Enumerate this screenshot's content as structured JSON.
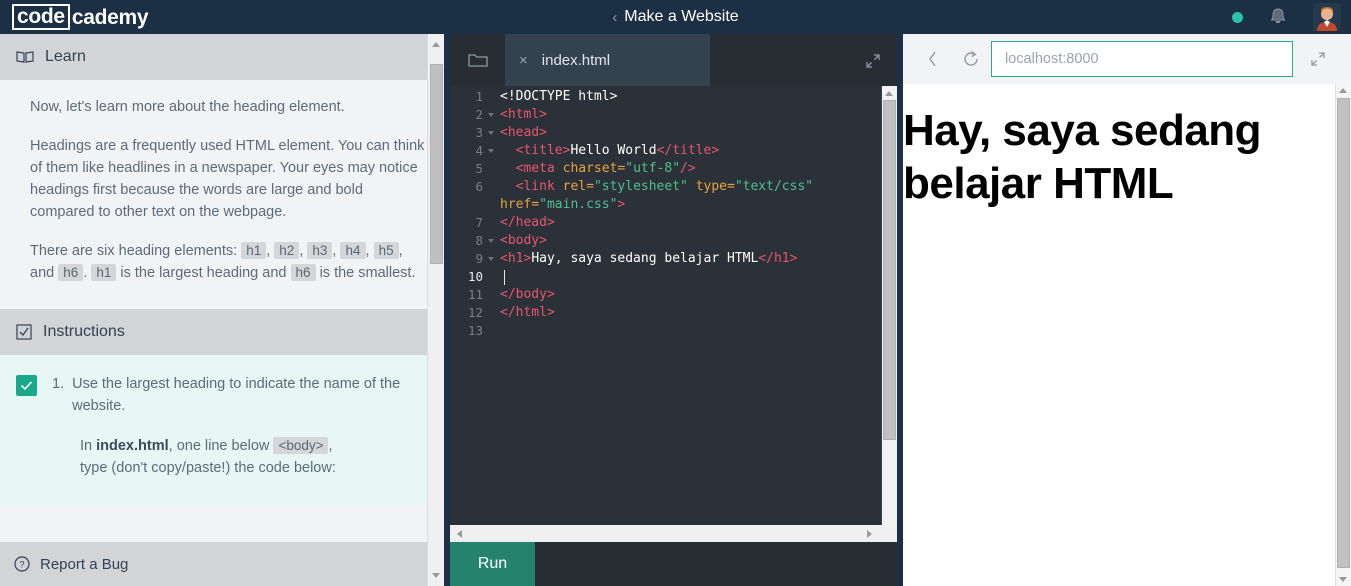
{
  "topbar": {
    "logo_boxed": "code",
    "logo_plain": "cademy",
    "back_chevron": "‹",
    "course_title": "Make a Website",
    "status_dot_color": "#29c3a8",
    "bell_icon": "bell-icon",
    "avatar_icon": "user-avatar"
  },
  "learn": {
    "header_label": "Learn",
    "header_icon": "book-icon",
    "paragraphs": [
      "Now, let's learn more about the heading element.",
      "Headings are a frequently used HTML element. You can think of them like headlines in a newspaper. Your eyes may notice headings first because the words are large and bold compared to other text on the webpage."
    ],
    "heading_sentence": {
      "pre": "There are six heading elements:",
      "codes": [
        "h1",
        "h2",
        "h3",
        "h4",
        "h5",
        "h6"
      ],
      "mid_and": "and",
      "tail_1": "h1",
      "tail_2": "is the largest heading and",
      "tail_3": "h6",
      "tail_4": "is the smallest."
    }
  },
  "instructions": {
    "header_label": "Instructions",
    "header_icon": "checkbox-checked-icon",
    "step_number": "1.",
    "step_checked": true,
    "step_text": "Use the largest heading to indicate the name of the website.",
    "sub_pre": "In",
    "sub_file": "index.html",
    "sub_mid": ", one line below",
    "sub_code": "<body>",
    "sub_post": ",",
    "sub_line2": "type (don't copy/paste!) the code below:"
  },
  "report_bug": {
    "label": "Report a Bug",
    "icon": "question-circle-icon"
  },
  "editor": {
    "folder_icon": "folder-icon",
    "tab_close_icon": "×",
    "tab_label": "index.html",
    "expand_icon": "expand-icon",
    "run_label": "Run",
    "active_line": 10,
    "lines": [
      {
        "n": "1",
        "fold": false,
        "tokens": [
          {
            "t": "<!DOCTYPE html>",
            "c": "tx"
          }
        ]
      },
      {
        "n": "2",
        "fold": true,
        "tokens": [
          {
            "t": "<html>",
            "c": "tg"
          }
        ]
      },
      {
        "n": "3",
        "fold": true,
        "tokens": [
          {
            "t": "<head>",
            "c": "tg"
          }
        ]
      },
      {
        "n": "4",
        "fold": true,
        "tokens": [
          {
            "t": "  <title>",
            "c": "tg"
          },
          {
            "t": "Hello World",
            "c": "tx"
          },
          {
            "t": "</title>",
            "c": "tg"
          }
        ]
      },
      {
        "n": "5",
        "fold": false,
        "tokens": [
          {
            "t": "  <meta ",
            "c": "tg"
          },
          {
            "t": "charset=",
            "c": "at"
          },
          {
            "t": "\"utf-8\"",
            "c": "st"
          },
          {
            "t": "/>",
            "c": "tg"
          }
        ]
      },
      {
        "n": "6",
        "fold": false,
        "tokens": [
          {
            "t": "  <link ",
            "c": "tg"
          },
          {
            "t": "rel=",
            "c": "at"
          },
          {
            "t": "\"stylesheet\"",
            "c": "st"
          },
          {
            "t": " ",
            "c": "tx"
          },
          {
            "t": "type=",
            "c": "at"
          },
          {
            "t": "\"text/css\"",
            "c": "st"
          }
        ]
      },
      {
        "n": "",
        "fold": false,
        "wrap": true,
        "tokens": [
          {
            "t": "href=",
            "c": "at"
          },
          {
            "t": "\"main.css\"",
            "c": "st"
          },
          {
            "t": ">",
            "c": "tg"
          }
        ]
      },
      {
        "n": "7",
        "fold": false,
        "tokens": [
          {
            "t": "</head>",
            "c": "tg"
          }
        ]
      },
      {
        "n": "8",
        "fold": true,
        "tokens": [
          {
            "t": "<body>",
            "c": "tg"
          }
        ]
      },
      {
        "n": "9",
        "fold": true,
        "tokens": [
          {
            "t": "<h1>",
            "c": "tg"
          },
          {
            "t": "Hay, saya sedang belajar HTML",
            "c": "tx"
          },
          {
            "t": "</h1>",
            "c": "tg"
          }
        ]
      },
      {
        "n": "10",
        "fold": false,
        "caret": true,
        "tokens": []
      },
      {
        "n": "11",
        "fold": false,
        "tokens": [
          {
            "t": "</body>",
            "c": "tg"
          }
        ]
      },
      {
        "n": "12",
        "fold": false,
        "tokens": [
          {
            "t": "</html>",
            "c": "tg"
          }
        ]
      },
      {
        "n": "13",
        "fold": false,
        "tokens": []
      }
    ]
  },
  "preview": {
    "back_icon": "chevron-left-icon",
    "reload_icon": "reload-icon",
    "url_value": "localhost:8000",
    "expand_icon": "expand-icon",
    "rendered_heading": "Hay, saya sedang belajar HTML",
    "url_border_color": "#2aa98c"
  }
}
